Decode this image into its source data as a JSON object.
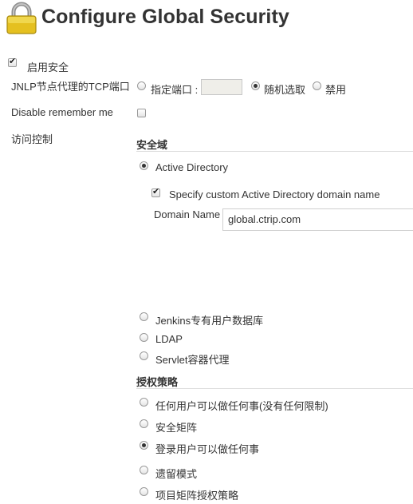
{
  "page": {
    "title": "Configure Global Security"
  },
  "enable_security": {
    "label": "启用安全",
    "checked": true
  },
  "jnlp": {
    "label": "JNLP节点代理的TCP端口",
    "options": [
      {
        "label": "指定端口 :",
        "selected": false
      },
      {
        "label": "随机选取",
        "selected": true
      },
      {
        "label": "禁用",
        "selected": false
      }
    ],
    "port_value": ""
  },
  "remember_me": {
    "label": "Disable remember me",
    "checked": false
  },
  "access_control": {
    "label": "访问控制"
  },
  "security_realm": {
    "title": "安全域",
    "options": [
      {
        "label": "Active Directory",
        "selected": true
      },
      {
        "label": "Jenkins专有用户数据库",
        "selected": false
      },
      {
        "label": "LDAP",
        "selected": false
      },
      {
        "label": "Servlet容器代理",
        "selected": false
      }
    ],
    "custom_domain": {
      "label": "Specify custom Active Directory domain name",
      "checked": true
    },
    "domain_name": {
      "label": "Domain Name",
      "value": "global.ctrip.com"
    }
  },
  "authorization": {
    "title": "授权策略",
    "options": [
      {
        "label": "任何用户可以做任何事(没有任何限制)",
        "selected": false
      },
      {
        "label": "安全矩阵",
        "selected": false
      },
      {
        "label": "登录用户可以做任何事",
        "selected": true
      },
      {
        "label": "遗留模式",
        "selected": false
      },
      {
        "label": "项目矩阵授权策略",
        "selected": false
      }
    ]
  },
  "colors": {
    "lock_gold": "#e5c020",
    "lock_shackle": "#9a9a9a",
    "text": "#333333",
    "divider": "#dcdcdc"
  },
  "icons": {
    "title_icon": "lock-icon"
  }
}
